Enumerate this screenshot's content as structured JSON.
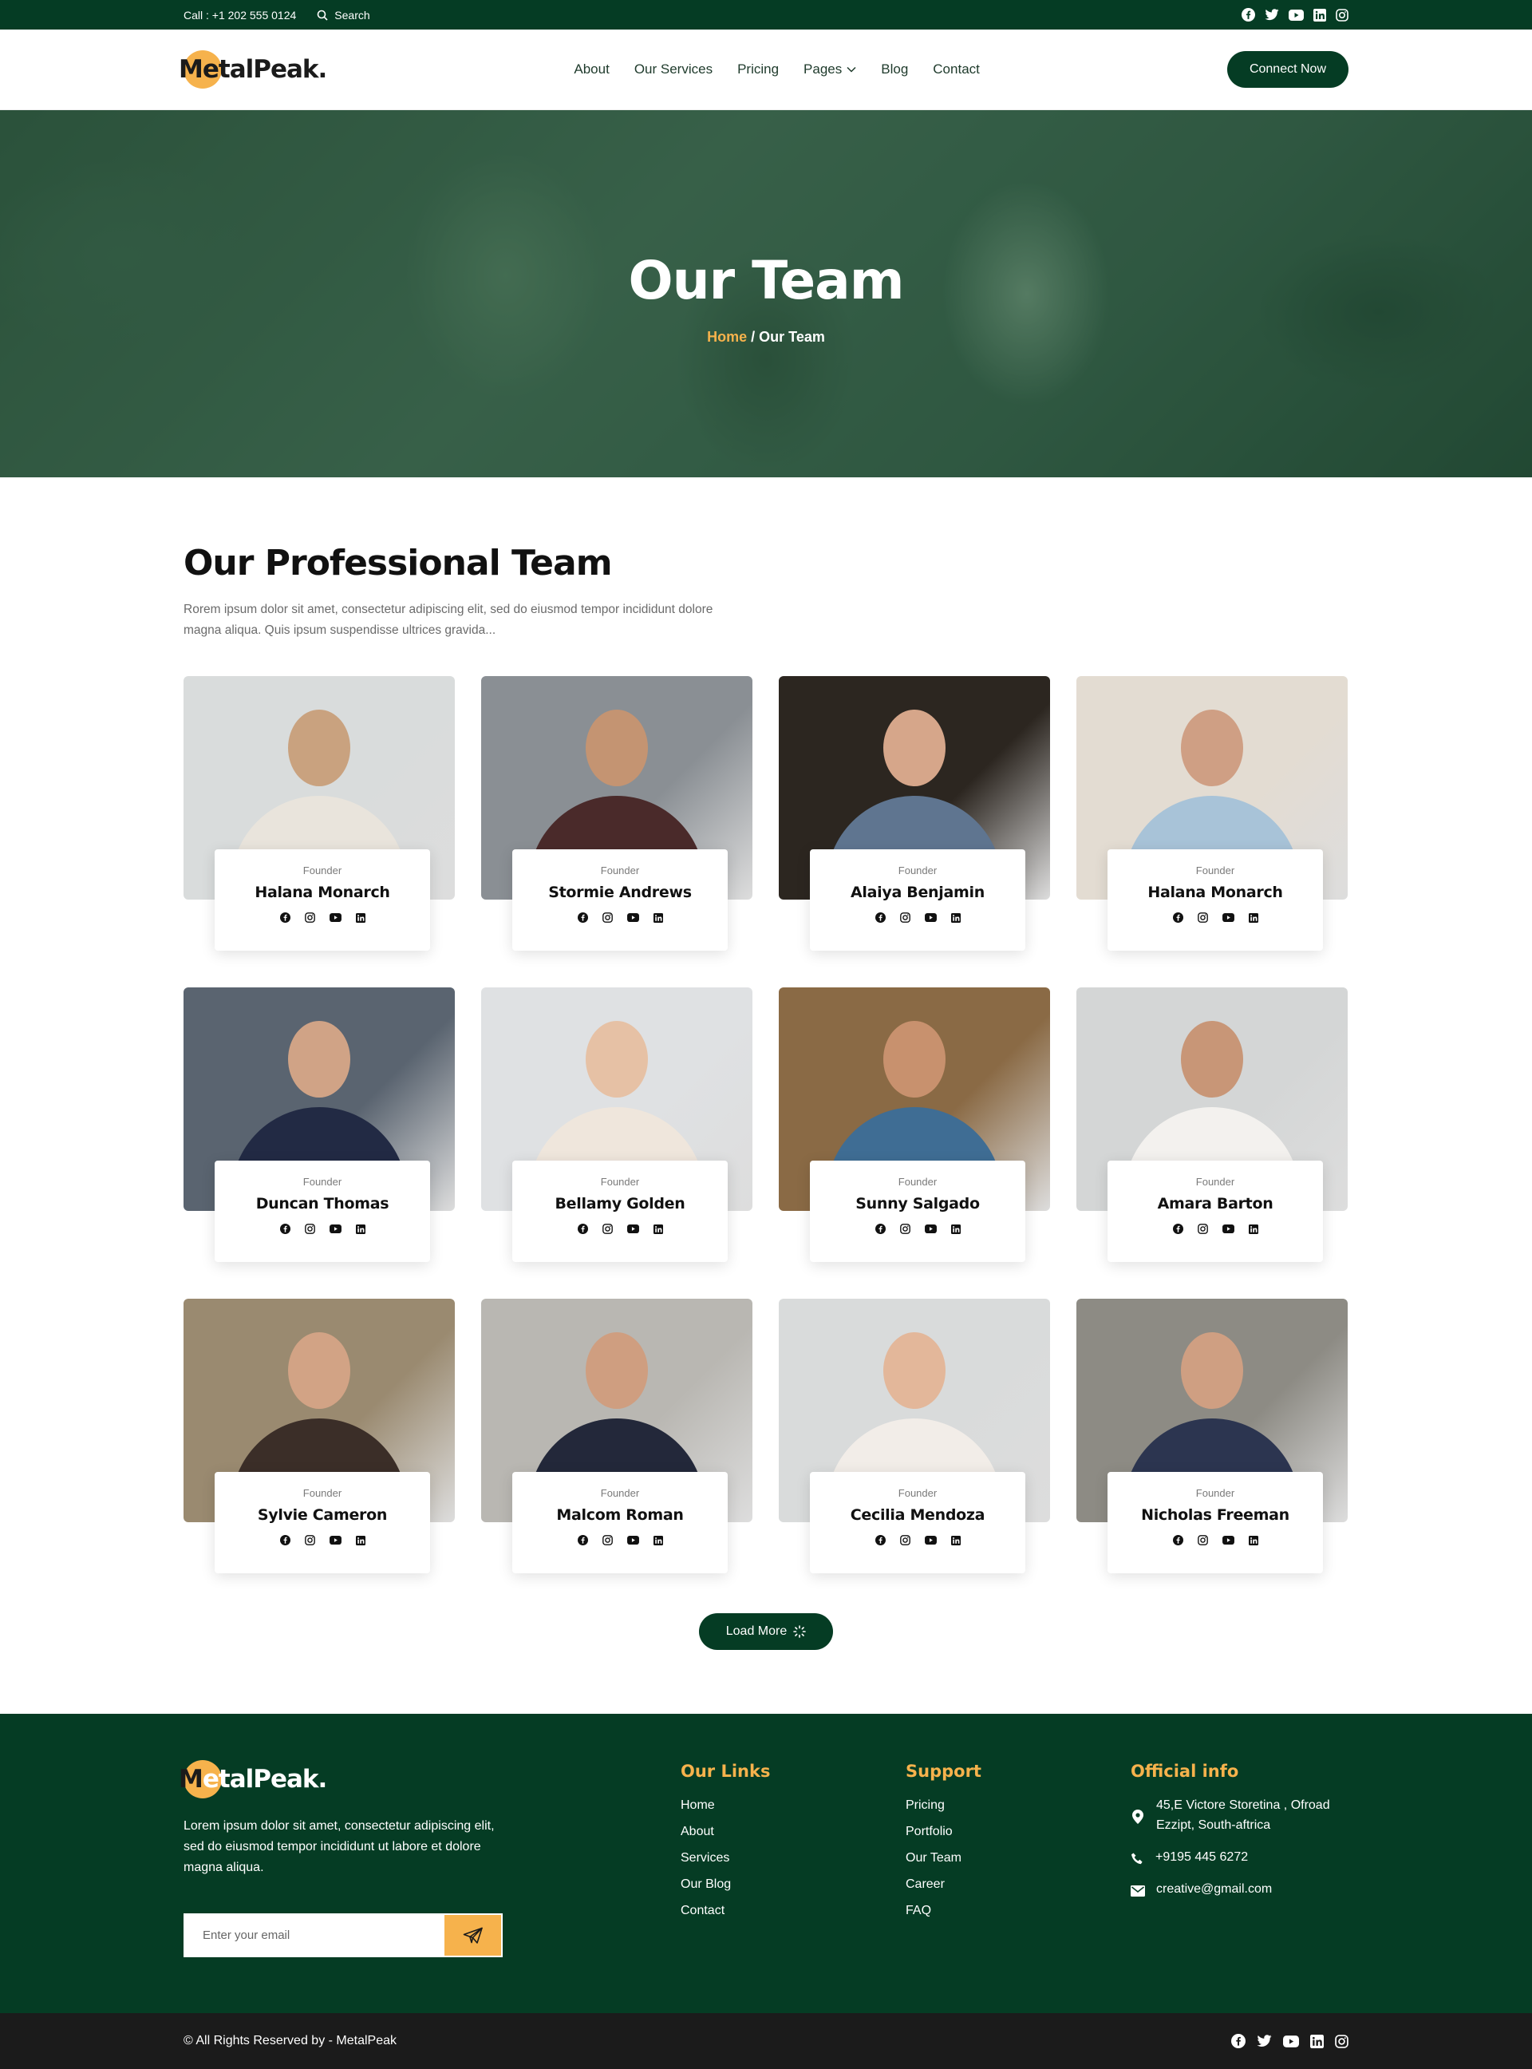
{
  "topbar": {
    "call_text": "Call : +1 202 555 0124",
    "search_label": "Search",
    "social": [
      "facebook-icon",
      "twitter-icon",
      "youtube-icon",
      "linkedin-icon",
      "instagram-icon"
    ]
  },
  "header": {
    "logo_initial": "M",
    "logo_rest": "etalPeak.",
    "nav": {
      "about": "About",
      "services": "Our Services",
      "pricing": "Pricing",
      "pages": "Pages",
      "blog": "Blog",
      "contact": "Contact"
    },
    "cta": "Connect Now"
  },
  "hero": {
    "title": "Our Team",
    "breadcrumb_home": "Home",
    "breadcrumb_sep": " / ",
    "breadcrumb_current": "Our Team"
  },
  "team": {
    "title": "Our Professional Team",
    "description": "Rorem ipsum dolor sit amet, consectetur adipiscing elit, sed do eiusmod tempor incididunt dolore magna aliqua. Quis ipsum suspendisse ultrices gravida...",
    "members": [
      {
        "role": "Founder",
        "name": "Halana Monarch"
      },
      {
        "role": "Founder",
        "name": "Stormie Andrews"
      },
      {
        "role": "Founder",
        "name": "Alaiya Benjamin"
      },
      {
        "role": "Founder",
        "name": "Halana Monarch"
      },
      {
        "role": "Founder",
        "name": "Duncan Thomas"
      },
      {
        "role": "Founder",
        "name": "Bellamy Golden"
      },
      {
        "role": "Founder",
        "name": "Sunny Salgado"
      },
      {
        "role": "Founder",
        "name": "Amara Barton"
      },
      {
        "role": "Founder",
        "name": "Sylvie Cameron"
      },
      {
        "role": "Founder",
        "name": "Malcom Roman"
      },
      {
        "role": "Founder",
        "name": "Cecilia Mendoza"
      },
      {
        "role": "Founder",
        "name": "Nicholas Freeman"
      }
    ],
    "load_more": "Load More"
  },
  "footer": {
    "logo_initial": "M",
    "logo_rest": "etalPeak.",
    "about_text": "Lorem ipsum dolor sit amet, consectetur adipiscing elit, sed do eiusmod tempor incididunt ut labore et dolore magna aliqua.",
    "email_placeholder": "Enter your email",
    "links_heading": "Our Links",
    "links": [
      "Home",
      "About",
      "Services",
      "Our Blog",
      "Contact"
    ],
    "support_heading": "Support",
    "support": [
      "Pricing",
      "Portfolio",
      "Our Team",
      "Career",
      "FAQ"
    ],
    "info_heading": "Official info",
    "address": "45,E Victore Storetina , Ofroad Ezzipt, South-aftrica",
    "phone": "+9195 445 6272",
    "email": "creative@gmail.com"
  },
  "bottombar": {
    "copyright": "© All Rights Reserved by - MetalPeak"
  },
  "colors": {
    "brand_green": "#053c24",
    "accent_orange": "#f6b24c",
    "dark": "#1b1b1b"
  }
}
